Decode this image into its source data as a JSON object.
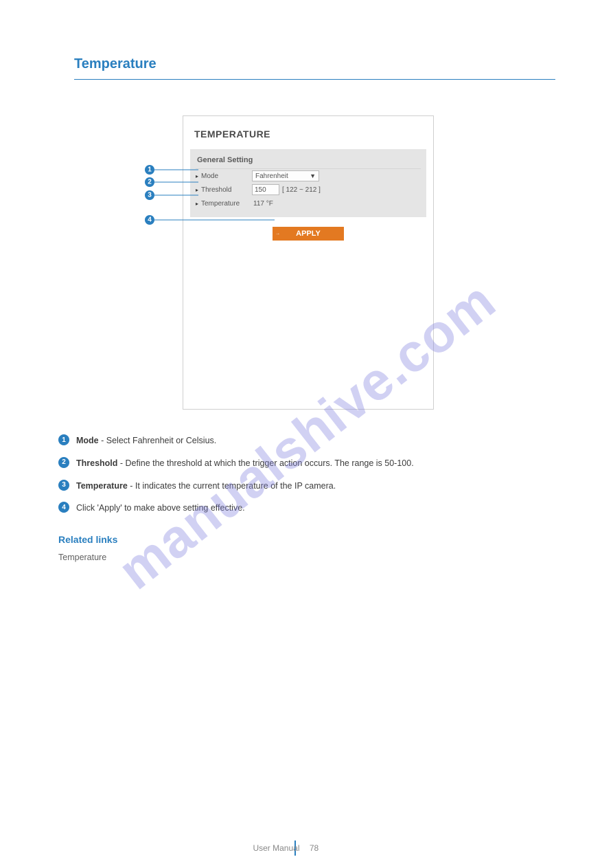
{
  "header": {
    "chapter_title": "Temperature"
  },
  "watermark": "manualshive.com",
  "screenshot": {
    "title": "TEMPERATURE",
    "card_heading": "General Setting",
    "rows": {
      "mode": {
        "label": "Mode",
        "value": "Fahrenheit"
      },
      "threshold": {
        "label": "Threshold",
        "value": "150",
        "range": "[ 122 ~ 212 ]"
      },
      "temperature": {
        "label": "Temperature",
        "value": "117 °F"
      }
    },
    "apply_label": "APPLY"
  },
  "callouts": {
    "c1": "1",
    "c2": "2",
    "c3": "3",
    "c4": "4"
  },
  "explain": {
    "items": [
      {
        "num": "1",
        "bold": "Mode",
        "rest": " - Select Fahrenheit or Celsius."
      },
      {
        "num": "2",
        "bold": "Threshold",
        "rest": " - Define the threshold at which the trigger action occurs. The range is 50-100."
      },
      {
        "num": "3",
        "bold": "Temperature",
        "rest": " - It indicates the current temperature of the IP camera."
      },
      {
        "num": "4",
        "bold": "",
        "rest": "Click 'Apply' to make above setting effective."
      }
    ],
    "related_title": "Related links",
    "related_link": "Temperature"
  },
  "footer": {
    "left": "User Manual",
    "right": "78"
  }
}
